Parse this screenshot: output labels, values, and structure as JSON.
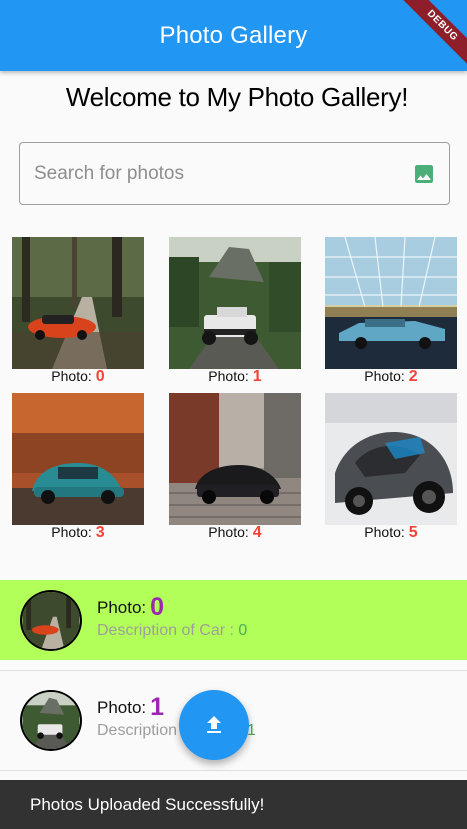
{
  "appbar": {
    "title": "Photo Gallery",
    "debug_label": "DEBUG"
  },
  "welcome": "Welcome to My Photo Gallery!",
  "search": {
    "placeholder": "Search for photos",
    "icon": "image-icon"
  },
  "grid": {
    "caption_label": "Photo:",
    "photos": [
      {
        "number": "0",
        "subject": "orange car on forest road"
      },
      {
        "number": "1",
        "subject": "white jeep in forest"
      },
      {
        "number": "2",
        "subject": "blue classic car in studio"
      },
      {
        "number": "3",
        "subject": "teal car in autumn"
      },
      {
        "number": "4",
        "subject": "black car on cobblestone"
      },
      {
        "number": "5",
        "subject": "grey sports car"
      }
    ]
  },
  "list": {
    "items": [
      {
        "title_label": "Photo:",
        "number": "0",
        "description_label": "Description of Car :",
        "description_number": "0",
        "selected": true
      },
      {
        "title_label": "Photo:",
        "number": "1",
        "description_label": "Description",
        "description_number": "1",
        "selected": false
      }
    ]
  },
  "fab": {
    "icon": "upload-icon"
  },
  "snackbar": {
    "message": "Photos Uploaded Successfully!"
  },
  "colors": {
    "primary": "#2196f3",
    "selected_row": "#b2ff59",
    "caption_number": "#f44336",
    "list_number": "#9c27b0",
    "description_number": "#4caf50"
  }
}
